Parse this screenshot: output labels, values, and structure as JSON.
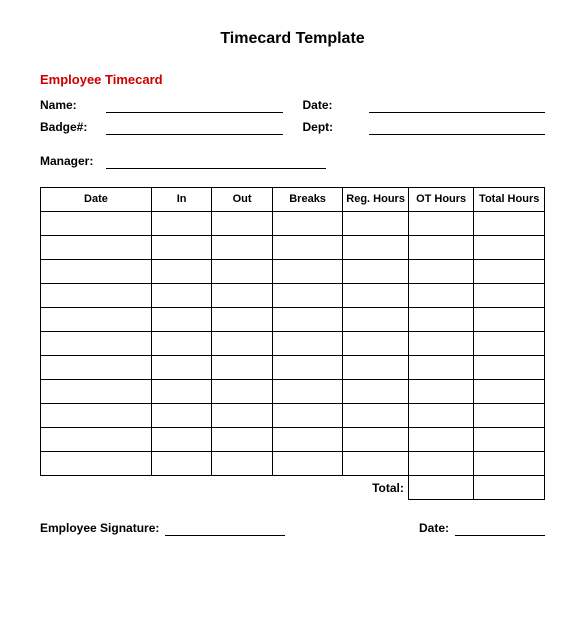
{
  "page": {
    "title": "Timecard Template",
    "section_title": "Employee Timecard",
    "fields": {
      "name_label": "Name:",
      "date_label": "Date:",
      "badge_label": "Badge#:",
      "dept_label": "Dept:",
      "manager_label": "Manager:"
    },
    "table": {
      "headers": {
        "date": "Date",
        "in": "In",
        "out": "Out",
        "breaks": "Breaks",
        "reg_hours": "Reg. Hours",
        "ot_hours": "OT Hours",
        "total_hours": "Total Hours"
      },
      "total_label": "Total:",
      "row_count": 11
    },
    "signature": {
      "employee_label": "Employee Signature:",
      "date_label": "Date:"
    }
  }
}
